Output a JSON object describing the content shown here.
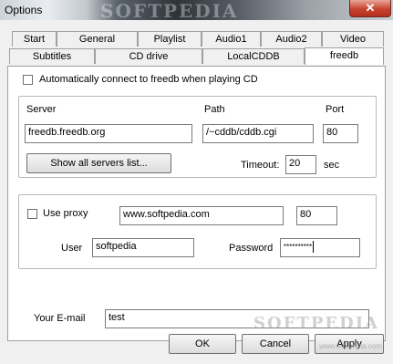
{
  "window": {
    "title": "Options",
    "close_glyph": "✕",
    "watermark": "SOFTPEDIA"
  },
  "tabs": {
    "row1": [
      "Start",
      "General",
      "Playlist",
      "Audio1",
      "Audio2",
      "Video"
    ],
    "row2": [
      "Subtitles",
      "CD drive",
      "LocalCDDB",
      "freedb"
    ],
    "selected": "freedb"
  },
  "freedb": {
    "auto_connect_label": "Automatically connect to freedb when playing CD",
    "auto_connect_checked": false,
    "server_label": "Server",
    "server_value": "freedb.freedb.org",
    "path_label": "Path",
    "path_value": "/~cddb/cddb.cgi",
    "port_label": "Port",
    "port_value": "80",
    "show_servers_label": "Show all servers list...",
    "timeout_label": "Timeout:",
    "timeout_value": "20",
    "timeout_unit": "sec",
    "use_proxy_label": "Use proxy",
    "use_proxy_checked": false,
    "proxy_host_value": "www.softpedia.com",
    "proxy_port_value": "80",
    "user_label": "User",
    "user_value": "softpedia",
    "password_label": "Password",
    "password_value": "**********",
    "email_label": "Your E-mail",
    "email_value": "test"
  },
  "buttons": {
    "ok": "OK",
    "cancel": "Cancel",
    "apply": "Apply"
  },
  "watermark_url": "www.softpedia.com"
}
